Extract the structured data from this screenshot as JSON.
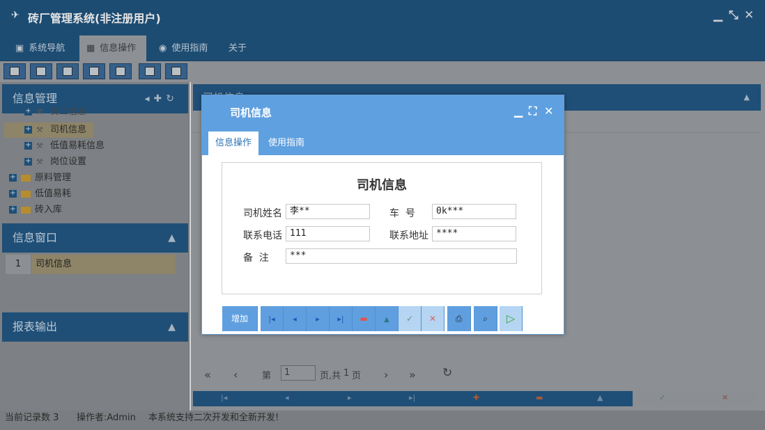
{
  "app": {
    "title": "砖厂管理系统(非注册用户)",
    "window_controls": [
      "minimize",
      "restore",
      "close"
    ]
  },
  "menu": {
    "tabs": [
      {
        "label": "系统导航",
        "icon": "monitor-icon"
      },
      {
        "label": "信息操作",
        "icon": "grid-icon"
      },
      {
        "label": "使用指南",
        "icon": "help-icon"
      },
      {
        "label": "关于",
        "icon": ""
      }
    ],
    "active": "信息操作"
  },
  "left": {
    "info_mgmt_title": "信息管理",
    "tree": [
      {
        "label": "员工信息",
        "level": 2,
        "icon": "tool-icon"
      },
      {
        "label": "司机信息",
        "level": 2,
        "icon": "tool-icon",
        "selected": true
      },
      {
        "label": "低值易耗信息",
        "level": 2,
        "icon": "tool-icon"
      },
      {
        "label": "岗位设置",
        "level": 2,
        "icon": "tool-icon"
      },
      {
        "label": "原料管理",
        "level": 1,
        "icon": "folder-icon"
      },
      {
        "label": "低值易耗",
        "level": 1,
        "icon": "folder-icon"
      },
      {
        "label": "砖入库",
        "level": 1,
        "icon": "folder-icon"
      }
    ],
    "info_window_title": "信息窗口",
    "window_list": [
      {
        "index": "1",
        "name": "司机信息"
      }
    ],
    "report_title": "报表输出"
  },
  "main": {
    "header": "司机信息",
    "pager": {
      "prefix": "第",
      "page": "1",
      "suffix": "页,共",
      "total": "1",
      "unit": "页"
    }
  },
  "status": {
    "records": "当前记录数 3",
    "operator": "操作者:Admin",
    "note": "本系统支持二次开发和全新开发!"
  },
  "modal": {
    "title": "司机信息",
    "tabs": [
      "信息操作",
      "使用指南"
    ],
    "form_title": "司机信息",
    "fields": {
      "name_label": "司机姓名",
      "name_value": "李**",
      "plate_label": "车  号",
      "plate_value": "0k***",
      "phone_label": "联系电话",
      "phone_value": "111",
      "address_label": "联系地址",
      "address_value": "****",
      "remark_label": "备  注",
      "remark_value": "***"
    },
    "buttons": {
      "add": "增加"
    }
  },
  "colors": {
    "modal_blue": "#5fa0e0",
    "app_dark_blue": "#1d4c72",
    "selected_row": "#8e8468"
  }
}
